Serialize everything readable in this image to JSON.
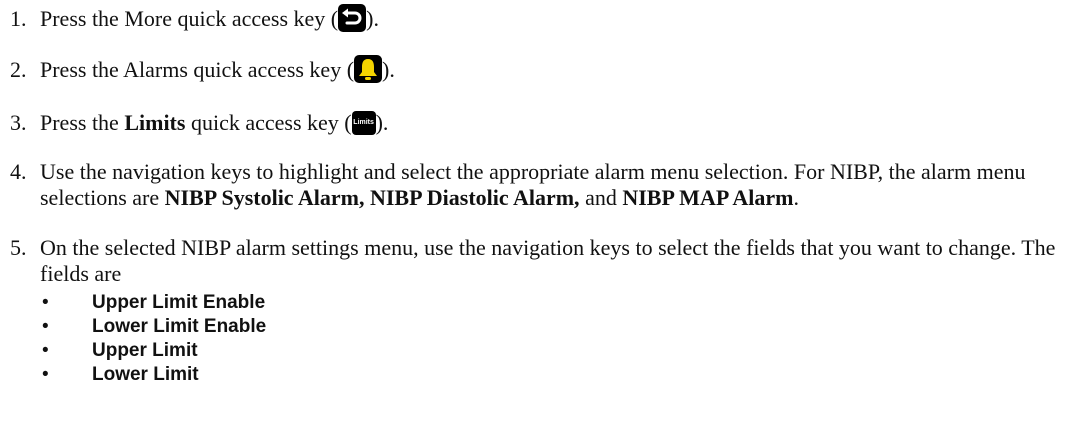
{
  "steps": [
    {
      "number": "1.",
      "before": "Press the More quick access key (",
      "key_icon": "more-return-arrow-icon",
      "after": ")."
    },
    {
      "number": "2.",
      "before": "Press the Alarms quick access key (",
      "key_icon": "alarm-bell-icon",
      "after": ")."
    },
    {
      "number": "3.",
      "before": "Press the ",
      "bold": "Limits",
      "middle": " quick access key (",
      "key_label": "Limits",
      "after": ")."
    },
    {
      "number": "4.",
      "text": "Use the navigation keys to highlight and select the appropriate alarm menu selection. For NIBP, the alarm menu selections are ",
      "bold_items": "NIBP Systolic Alarm, NIBP Diastolic Alarm,",
      "and_text": " and ",
      "bold_last": "NIBP MAP Alarm",
      "end": "."
    },
    {
      "number": "5.",
      "text": "On the selected NIBP alarm settings menu, use the navigation keys to select the fields that you want to change. The fields are",
      "fields": [
        "Upper Limit Enable",
        "Lower Limit Enable",
        "Upper Limit",
        "Lower Limit"
      ]
    }
  ],
  "bullet": "•",
  "colors": {
    "text": "#111111",
    "key_background": "#000000",
    "alarm_bell": "#f5d400",
    "key_glyph": "#ffffff"
  }
}
